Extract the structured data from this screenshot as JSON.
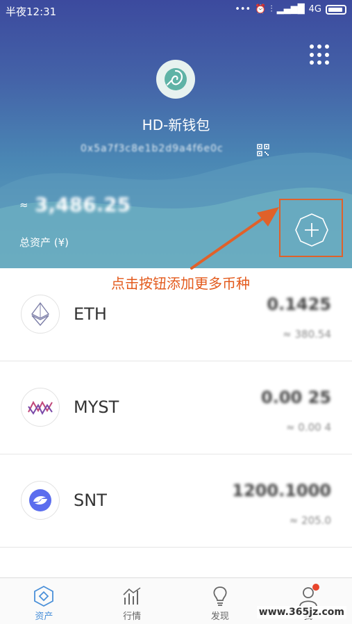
{
  "status_bar": {
    "time": "半夜12:31",
    "network": "4G",
    "icons": [
      "more-icon",
      "alarm-icon",
      "vibrate-icon",
      "signal-icon",
      "battery-icon"
    ]
  },
  "wallet": {
    "name": "HD-新钱包",
    "address": "0x5a7f3c8e1b2d9a4f6e0c"
  },
  "balance": {
    "approx": "≈",
    "total": "3,486.25",
    "label": "总资产 (¥)"
  },
  "annotation": {
    "text": "点击按钮添加更多币种",
    "color": "#e35a1c"
  },
  "tokens": [
    {
      "symbol": "ETH",
      "amount": "0.1425",
      "value": "≈ 380.54",
      "icon": "eth-icon"
    },
    {
      "symbol": "MYST",
      "amount": "0.00 25",
      "value": "≈ 0.00 4",
      "icon": "myst-icon"
    },
    {
      "symbol": "SNT",
      "amount": "1200.1000",
      "value": "≈ 205.0",
      "icon": "snt-icon"
    }
  ],
  "bottom_nav": [
    {
      "label": "资产",
      "icon": "assets-icon",
      "active": true
    },
    {
      "label": "行情",
      "icon": "market-chart-icon",
      "active": false
    },
    {
      "label": "发现",
      "icon": "lightbulb-icon",
      "active": false
    },
    {
      "label": "我",
      "icon": "profile-icon",
      "active": false
    }
  ],
  "watermark": "www.365jz.com",
  "colors": {
    "header_top": "#3c4a9e",
    "header_bottom": "#67a8be",
    "accent": "#4a90d9",
    "highlight": "#e0612a"
  }
}
